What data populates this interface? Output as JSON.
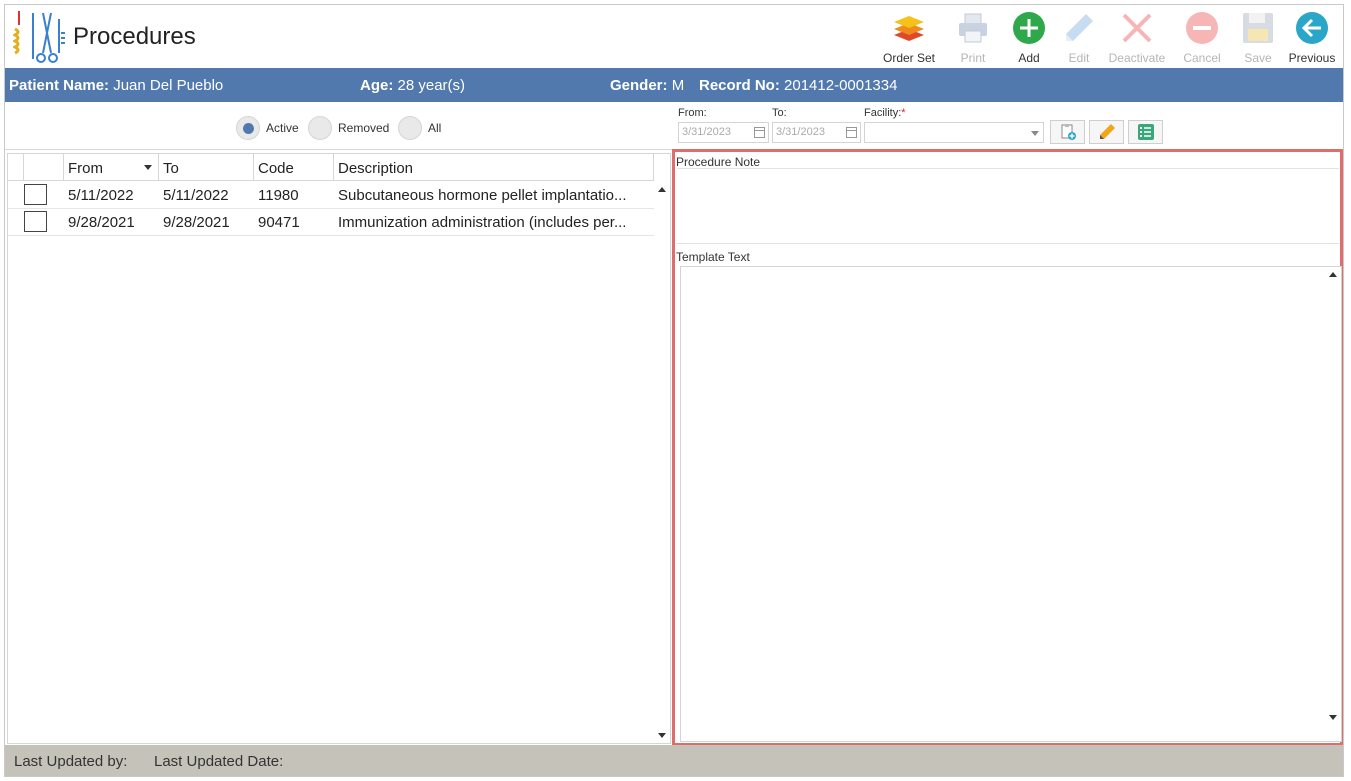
{
  "app": {
    "title": "Procedures"
  },
  "toolbar": {
    "buttons": [
      {
        "label": "Order Set",
        "icon": "layers-icon"
      },
      {
        "label": "Print",
        "icon": "printer-icon"
      },
      {
        "label": "Add",
        "icon": "plus-circle-icon"
      },
      {
        "label": "Edit",
        "icon": "pencil-icon"
      },
      {
        "label": "Deactivate",
        "icon": "x-icon"
      },
      {
        "label": "Cancel",
        "icon": "minus-circle-icon"
      },
      {
        "label": "Save",
        "icon": "floppy-disk-icon"
      },
      {
        "label": "Previous",
        "icon": "arrow-left-circle-icon"
      }
    ]
  },
  "patient": {
    "name_label": "Patient Name:",
    "name": "Juan Del Pueblo",
    "age_label": "Age:",
    "age": "28 year(s)",
    "gender_label": "Gender:",
    "gender": "M",
    "record_label": "Record No:",
    "record": "201412-0001334"
  },
  "filters": {
    "status_options": [
      {
        "label": "Active",
        "selected": true
      },
      {
        "label": "Removed",
        "selected": false
      },
      {
        "label": "All",
        "selected": false
      }
    ],
    "from_label": "From:",
    "from_value": "3/31/2023",
    "to_label": "To:",
    "to_value": "3/31/2023",
    "facility_label": "Facility:",
    "facility_required": "*",
    "facility_value": ""
  },
  "grid": {
    "columns": [
      "From",
      "To",
      "Code",
      "Description"
    ],
    "rows": [
      {
        "from": "5/11/2022",
        "to": "5/11/2022",
        "code": "11980",
        "description": "Subcutaneous hormone pellet implantatio..."
      },
      {
        "from": "9/28/2021",
        "to": "9/28/2021",
        "code": "90471",
        "description": "Immunization administration (includes per..."
      }
    ]
  },
  "note_panel": {
    "procedure_note_label": "Procedure Note",
    "template_text_label": "Template Text"
  },
  "footer": {
    "updated_by_label": "Last Updated by:",
    "updated_date_label": "Last Updated Date:"
  },
  "colors": {
    "patient_bar": "#5179ad",
    "footer": "#c5c3b9",
    "highlight_border": "#e06c6c",
    "add_green": "#2ea84a",
    "previous_teal": "#2aa6c8"
  }
}
